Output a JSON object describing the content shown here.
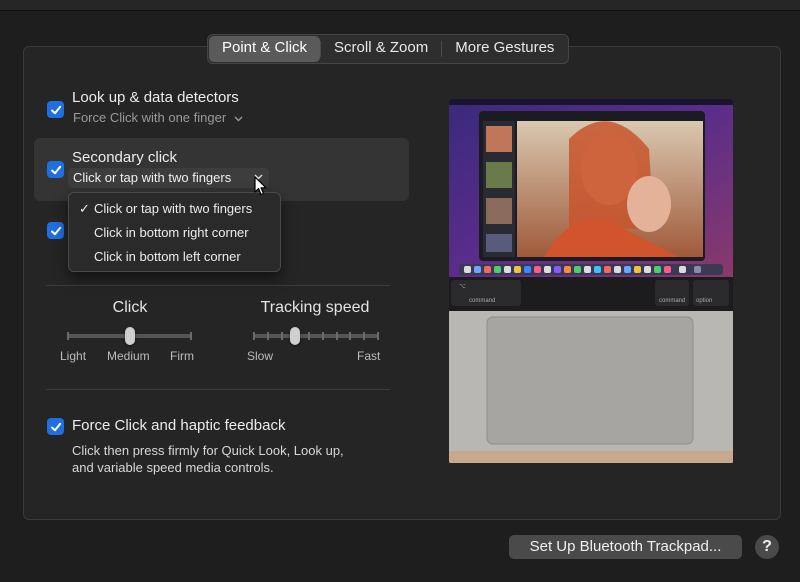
{
  "tabs": [
    {
      "label": "Point & Click",
      "active": true
    },
    {
      "label": "Scroll & Zoom",
      "active": false
    },
    {
      "label": "More Gestures",
      "active": false
    }
  ],
  "lookup": {
    "label": "Look up & data detectors",
    "value": "Force Click with one finger",
    "checked": true
  },
  "secondary": {
    "label": "Secondary click",
    "value": "Click or tap with two fingers",
    "checked": true
  },
  "third_checkbox": {
    "checked": true
  },
  "secondary_menu": {
    "options": [
      "Click or tap with two fingers",
      "Click in bottom right corner",
      "Click in bottom left corner"
    ],
    "selected_index": 0
  },
  "click_slider": {
    "title": "Click",
    "labels": [
      "Light",
      "Medium",
      "Firm"
    ],
    "value_index": 1,
    "steps": 3
  },
  "tracking_slider": {
    "title": "Tracking speed",
    "min_label": "Slow",
    "max_label": "Fast",
    "value_fraction": 0.33
  },
  "force_click": {
    "label": "Force Click and haptic feedback",
    "description_line1": "Click then press firmly for Quick Look, Look up,",
    "description_line2": "and variable speed media controls.",
    "checked": true
  },
  "preview_keys": {
    "left": "command",
    "right1": "command",
    "right2": "option"
  },
  "footer": {
    "bt_button": "Set Up Bluetooth Trackpad...",
    "help": "?"
  },
  "colors": {
    "accent": "#1f6fde",
    "background": "#1e1e1e",
    "panel": "#252525"
  }
}
